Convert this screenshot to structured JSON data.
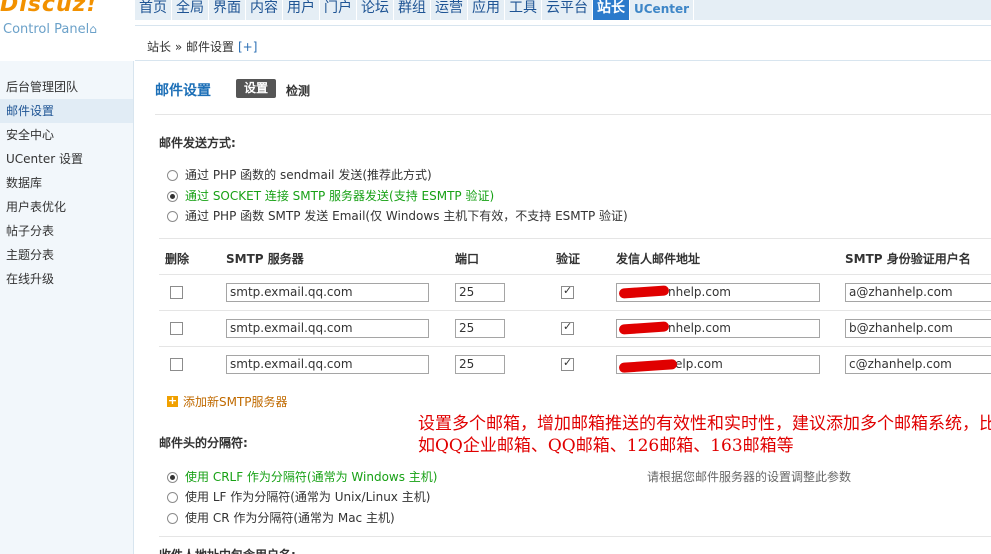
{
  "logo": {
    "brand": "Discuz!",
    "subtitle": "Control Panel"
  },
  "topnav": [
    "首页",
    "全局",
    "界面",
    "内容",
    "用户",
    "门户",
    "论坛",
    "群组",
    "运营",
    "应用",
    "工具",
    "云平台",
    "站长",
    "UCenter"
  ],
  "breadcrumb": {
    "path": "站长 » 邮件设置",
    "plus": "[+]"
  },
  "sidebar": [
    "后台管理团队",
    "邮件设置",
    "安全中心",
    "UCenter 设置",
    "数据库",
    "用户表优化",
    "帖子分表",
    "主题分表",
    "在线升级"
  ],
  "page": {
    "title": "邮件设置",
    "tab_active": "设置",
    "tab_other": "检测"
  },
  "send_method": {
    "heading": "邮件发送方式:",
    "options": [
      "通过 PHP 函数的 sendmail 发送(推荐此方式)",
      "通过 SOCKET 连接 SMTP 服务器发送(支持 ESMTP 验证)",
      "通过 PHP 函数 SMTP 发送 Email(仅 Windows 主机下有效，不支持 ESMTP 验证)"
    ],
    "selected_index": 1
  },
  "smtp_table": {
    "headers": [
      "删除",
      "SMTP 服务器",
      "端口",
      "验证",
      "发信人邮件地址",
      "SMTP 身份验证用户名"
    ],
    "rows": [
      {
        "server": "smtp.exmail.qq.com",
        "port": "25",
        "auth": true,
        "from": "nhelp.com",
        "username": "a@zhanhelp.com"
      },
      {
        "server": "smtp.exmail.qq.com",
        "port": "25",
        "auth": true,
        "from": "nhelp.com",
        "username": "b@zhanhelp.com"
      },
      {
        "server": "smtp.exmail.qq.com",
        "port": "25",
        "auth": true,
        "from": "elp.com",
        "username": "c@zhanhelp.com"
      }
    ],
    "add_label": "添加新SMTP服务器"
  },
  "annotation": "设置多个邮箱，增加邮箱推送的有效性和实时性，建议添加多个邮箱系统，比如QQ企业邮箱、QQ邮箱、126邮箱、163邮箱等",
  "separator": {
    "heading": "邮件头的分隔符:",
    "options": [
      "使用 CRLF 作为分隔符(通常为 Windows 主机)",
      "使用 LF 作为分隔符(通常为 Unix/Linux 主机)",
      "使用 CR 作为分隔符(通常为 Mac 主机)"
    ],
    "selected_index": 0,
    "hint": "请根据您邮件服务器的设置调整此参数"
  },
  "next_heading": "收件人地址中包含用户名:"
}
